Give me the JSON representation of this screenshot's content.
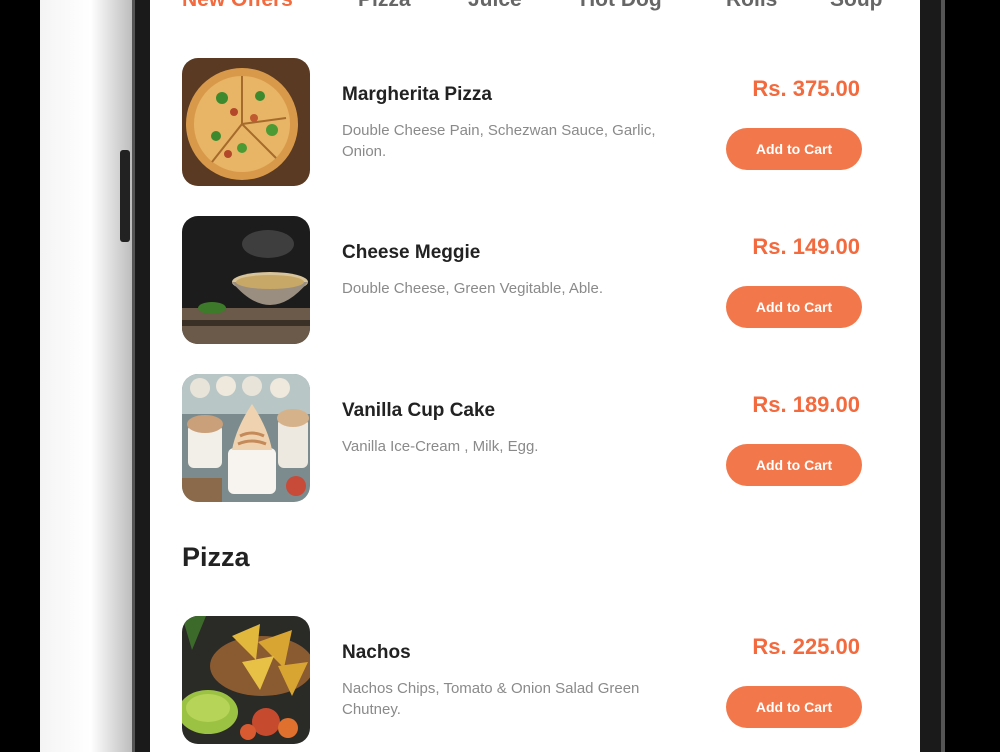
{
  "tabs": [
    {
      "label": "New Offers",
      "active": true
    },
    {
      "label": "Pizza",
      "active": false
    },
    {
      "label": "Juice",
      "active": false
    },
    {
      "label": "Hot Dog",
      "active": false
    },
    {
      "label": "Rolls",
      "active": false
    },
    {
      "label": "Soup",
      "active": false
    }
  ],
  "offers": [
    {
      "name": "Margherita Pizza",
      "desc": "Double Cheese Pain, Schezwan Sauce, Garlic, Onion.",
      "price": "Rs. 375.00",
      "button": "Add to Cart",
      "image": "pizza-photo"
    },
    {
      "name": "Cheese Meggie",
      "desc": "Double Cheese, Green Vegitable, Able.",
      "price": "Rs. 149.00",
      "button": "Add to Cart",
      "image": "noodle-bowl-photo"
    },
    {
      "name": "Vanilla Cup Cake",
      "desc": "Vanilla Ice-Cream , Milk, Egg.",
      "price": "Rs. 189.00",
      "button": "Add to Cart",
      "image": "cupcake-photo"
    }
  ],
  "pizza_section": {
    "title": "Pizza",
    "items": [
      {
        "name": "Nachos",
        "desc": "Nachos Chips, Tomato & Onion Salad Green Chutney.",
        "price": "Rs. 225.00",
        "button": "Add to Cart",
        "image": "nachos-photo"
      }
    ]
  },
  "colors": {
    "accent": "#f26a3d",
    "button": "#f2784b"
  }
}
